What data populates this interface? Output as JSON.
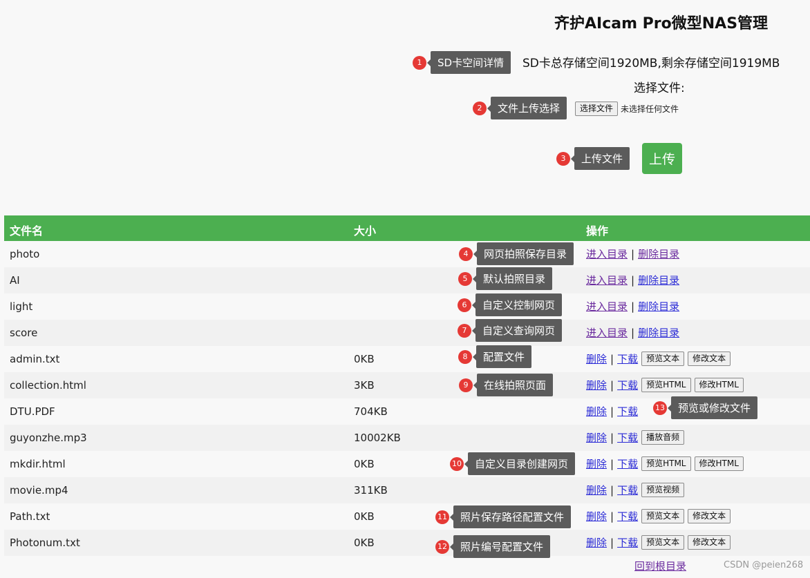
{
  "header": {
    "title": "齐护AIcam Pro微型NAS管理",
    "storage_info": "SD卡总存储空间1920MB,剩余存储空间1919MB",
    "choose_label": "选择文件:",
    "choose_button": "选择文件",
    "no_file_text": "未选择任何文件",
    "upload_button": "上传"
  },
  "table": {
    "headers": [
      "文件名",
      "大小",
      "操作"
    ],
    "rows": [
      {
        "name": "photo",
        "size": "",
        "ops": [
          "进入目录",
          "删除目录"
        ]
      },
      {
        "name": "AI",
        "size": "",
        "ops": [
          "进入目录",
          "删除目录"
        ]
      },
      {
        "name": "light",
        "size": "",
        "ops": [
          "进入目录",
          "删除目录"
        ]
      },
      {
        "name": "score",
        "size": "",
        "ops": [
          "进入目录",
          "删除目录"
        ]
      },
      {
        "name": "admin.txt",
        "size": "0KB",
        "ops": [
          "删除",
          "下载"
        ],
        "buttons": [
          "预览文本",
          "修改文本"
        ]
      },
      {
        "name": "collection.html",
        "size": "3KB",
        "ops": [
          "删除",
          "下载"
        ],
        "buttons": [
          "预览HTML",
          "修改HTML"
        ]
      },
      {
        "name": "DTU.PDF",
        "size": "704KB",
        "ops": [
          "删除",
          "下载"
        ],
        "buttons": []
      },
      {
        "name": "guyonzhe.mp3",
        "size": "10002KB",
        "ops": [
          "删除",
          "下载"
        ],
        "buttons": [
          "播放音频"
        ]
      },
      {
        "name": "mkdir.html",
        "size": "0KB",
        "ops": [
          "删除",
          "下载"
        ],
        "buttons": [
          "预览HTML",
          "修改HTML"
        ]
      },
      {
        "name": "movie.mp4",
        "size": "311KB",
        "ops": [
          "删除",
          "下载"
        ],
        "buttons": [
          "预览视频"
        ]
      },
      {
        "name": "Path.txt",
        "size": "0KB",
        "ops": [
          "删除",
          "下载"
        ],
        "buttons": [
          "预览文本",
          "修改文本"
        ]
      },
      {
        "name": "Photonum.txt",
        "size": "0KB",
        "ops": [
          "删除",
          "下载"
        ],
        "buttons": [
          "预览文本",
          "修改文本"
        ]
      }
    ],
    "separator": "|"
  },
  "back_link": "回到根目录",
  "watermark": "CSDN @peien268",
  "annotations": [
    {
      "num": "1",
      "label": "SD卡空间详情"
    },
    {
      "num": "2",
      "label": "文件上传选择"
    },
    {
      "num": "3",
      "label": "上传文件"
    },
    {
      "num": "4",
      "label": "网页拍照保存目录"
    },
    {
      "num": "5",
      "label": "默认拍照目录"
    },
    {
      "num": "6",
      "label": "自定义控制网页"
    },
    {
      "num": "7",
      "label": "自定义查询网页"
    },
    {
      "num": "8",
      "label": "配置文件"
    },
    {
      "num": "9",
      "label": "在线拍照页面"
    },
    {
      "num": "10",
      "label": "自定义目录创建网页"
    },
    {
      "num": "11",
      "label": "照片保存路径配置文件"
    },
    {
      "num": "12",
      "label": "照片编号配置文件"
    },
    {
      "num": "13",
      "label": "预览或修改文件"
    }
  ],
  "colors": {
    "accent": "#4caf50",
    "annotation_badge": "#e53935",
    "annotation_label_bg": "#5b5b5b"
  }
}
